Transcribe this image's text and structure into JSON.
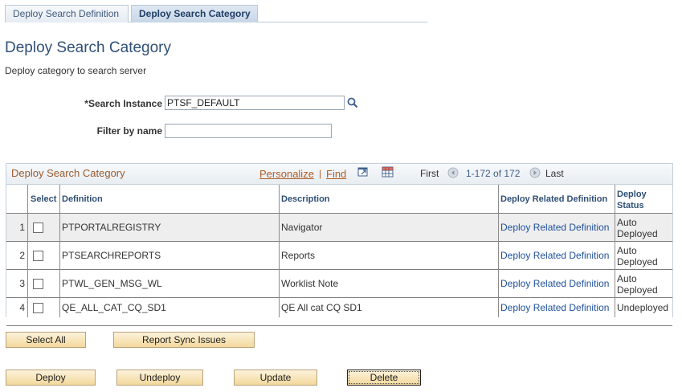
{
  "tabs": [
    {
      "label": "Deploy Search Definition"
    },
    {
      "label": "Deploy Search Category"
    }
  ],
  "page": {
    "title": "Deploy Search Category",
    "subtitle": "Deploy category to search server"
  },
  "form": {
    "search_instance_required": "*",
    "search_instance_label": "Search Instance",
    "search_instance_value": "PTSF_DEFAULT",
    "filter_label": "Filter by name",
    "filter_value": ""
  },
  "grid": {
    "title": "Deploy Search Category",
    "personalize": "Personalize",
    "separator": "|",
    "find": "Find",
    "first": "First",
    "range": "1-172 of 172",
    "last": "Last",
    "columns": {
      "select": "Select",
      "definition": "Definition",
      "description": "Description",
      "related": "Deploy Related Definition",
      "status_line1": "Deploy",
      "status_line2": "Status"
    },
    "rows": [
      {
        "num": "1",
        "definition": "PTPORTALREGISTRY",
        "description": "Navigator",
        "related": "Deploy Related Definition",
        "status1": "Auto",
        "status2": "Deployed",
        "checked": false
      },
      {
        "num": "2",
        "definition": "PTSEARCHREPORTS",
        "description": "Reports",
        "related": "Deploy Related Definition",
        "status1": "Auto",
        "status2": "Deployed",
        "checked": false
      },
      {
        "num": "3",
        "definition": "PTWL_GEN_MSG_WL",
        "description": "Worklist Note",
        "related": "Deploy Related Definition",
        "status1": "Auto",
        "status2": "Deployed",
        "checked": false
      },
      {
        "num": "4",
        "definition": "QE_ALL_CAT_CQ_SD1",
        "description": "QE All cat CQ SD1",
        "related": "Deploy Related Definition",
        "status1": "Undeployed",
        "status2": "",
        "checked": false
      }
    ]
  },
  "buttons": {
    "select_all": "Select All",
    "report_sync": "Report Sync Issues",
    "deploy": "Deploy",
    "undeploy": "Undeploy",
    "update": "Update",
    "delete": "Delete"
  },
  "icons": {
    "lookup": "magnifier-icon",
    "zoom": "zoom-icon",
    "download": "download-grid-icon",
    "prev": "previous-arrow-icon",
    "next": "next-arrow-icon"
  }
}
